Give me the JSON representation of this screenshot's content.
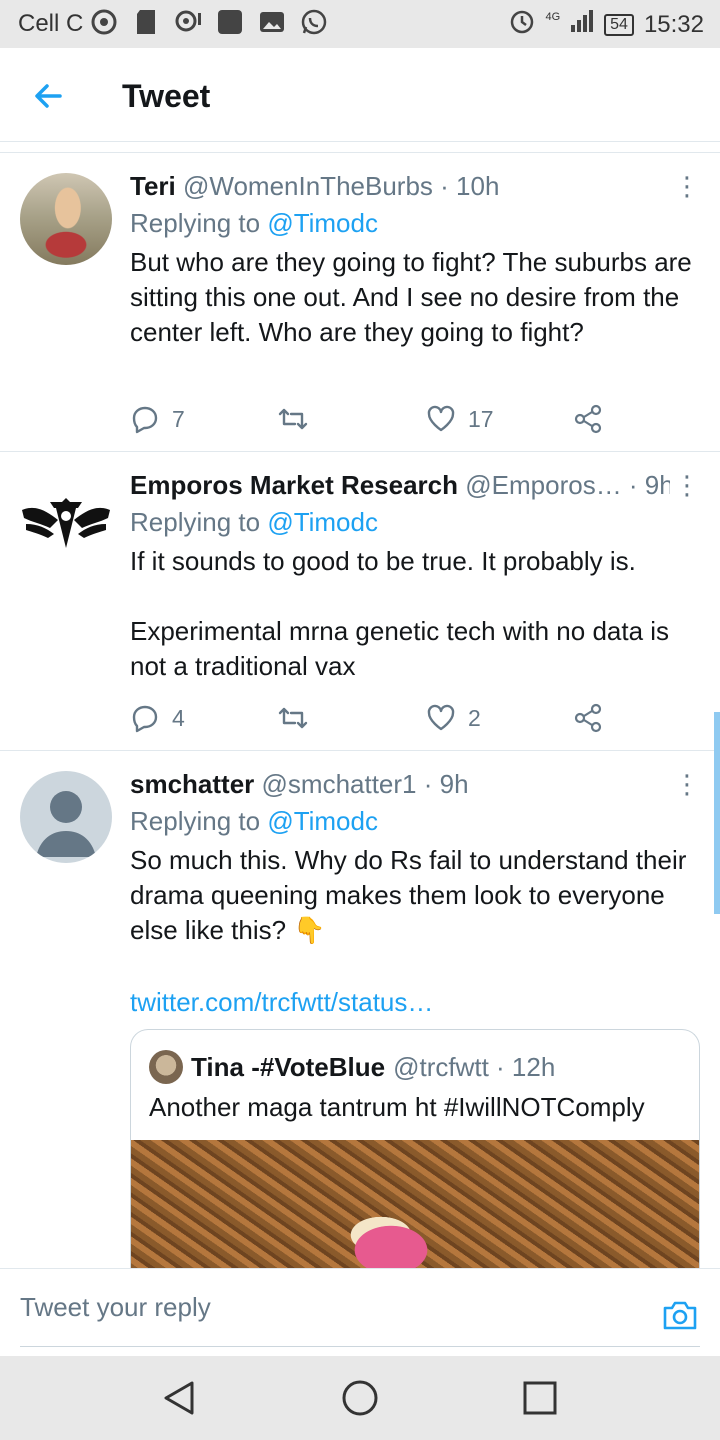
{
  "status_bar": {
    "carrier": "Cell C",
    "network": "4G",
    "battery": "54",
    "time": "15:32"
  },
  "header": {
    "title": "Tweet",
    "back_icon": "arrow-left-icon"
  },
  "tweets": [
    {
      "name": "Teri",
      "handle": "@WomenInTheBurbs",
      "time": " · 10h",
      "replying_prefix": "Replying to ",
      "replying_to": "@Timodc",
      "text": "But who are they going to fight?  The suburbs are sitting this one out.  And I see no desire from the center left. Who are they going to fight?",
      "replies": "7",
      "retweets": "",
      "likes": "17"
    },
    {
      "name": "Emporos Market Research",
      "handle": "@Emporos…",
      "time": " · 9h",
      "replying_prefix": "Replying to ",
      "replying_to": "@Timodc",
      "text": "If it sounds to good to be true. It probably is.\n\nExperimental mrna genetic tech with no data is not a traditional vax",
      "replies": "4",
      "retweets": "",
      "likes": "2"
    },
    {
      "name": "smchatter",
      "handle": "@smchatter1",
      "time": " · 9h",
      "replying_prefix": "Replying to ",
      "replying_to": "@Timodc",
      "text": "So much this. Why do Rs fail to understand their drama queening makes them look to everyone else like this? 👇",
      "url": "twitter.com/trcfwtt/status…",
      "quote": {
        "name": "Tina -#VoteBlue",
        "handle": "@trcfwtt",
        "time": " · 12h",
        "text": "Another maga tantrum ht #IwillNOTComply"
      }
    }
  ],
  "reply_bar": {
    "placeholder": "Tweet your reply"
  },
  "colors": {
    "accent": "#1da1f2",
    "secondary_text": "#657786"
  }
}
